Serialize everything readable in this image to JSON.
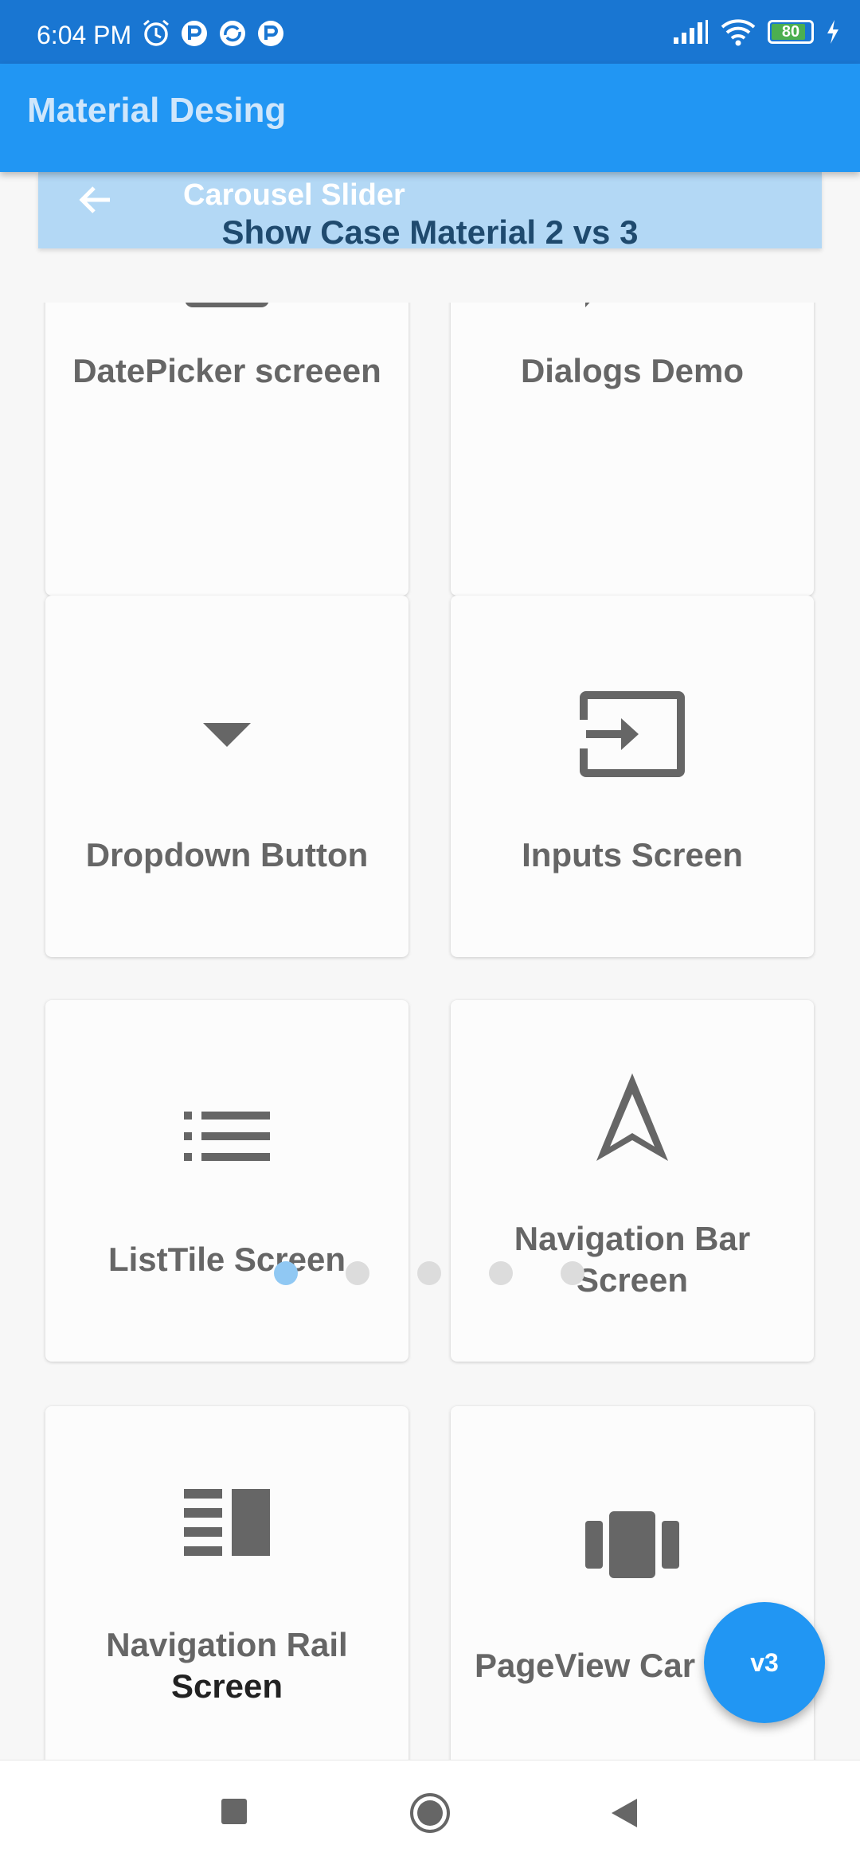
{
  "status_bar": {
    "time": "6:04 PM",
    "battery": "80",
    "icons_left": [
      "alarm-icon",
      "notification-icon",
      "sync-icon",
      "notification-icon"
    ],
    "icons_right": [
      "signal-icon",
      "wifi-icon",
      "battery-icon",
      "charging-icon"
    ]
  },
  "app_bar": {
    "title": "Material Desing",
    "color": "#2196f3"
  },
  "carousel": {
    "back_icon": "arrow-back-icon",
    "title": "Carousel Slider",
    "subtitle": "Show Case Material 2 vs 3",
    "dots_total": 5,
    "active_dot": 0
  },
  "cards": [
    {
      "label": "DatePicker screeen",
      "icon": "calendar-icon"
    },
    {
      "label": "Dialogs Demo",
      "icon": "chat-bubble-icon"
    },
    {
      "label": "Dropdown Button",
      "icon": "dropdown-arrow-icon"
    },
    {
      "label": "Inputs Screen",
      "icon": "input-icon"
    },
    {
      "label": "ListTile Screen",
      "icon": "list-icon"
    },
    {
      "label_line1": "Navigation Bar",
      "label_line2": "Screen",
      "icon": "navigation-icon"
    },
    {
      "label_line1": "Navigation Rail",
      "label_line2": "Screen",
      "icon": "view-sidebar-icon"
    },
    {
      "label": "PageView Car",
      "icon": "view-carousel-icon"
    }
  ],
  "fab": {
    "label": "v3",
    "color": "#2196f3"
  },
  "nav_bar": {
    "buttons": [
      "recents-icon",
      "home-icon",
      "back-icon"
    ]
  }
}
